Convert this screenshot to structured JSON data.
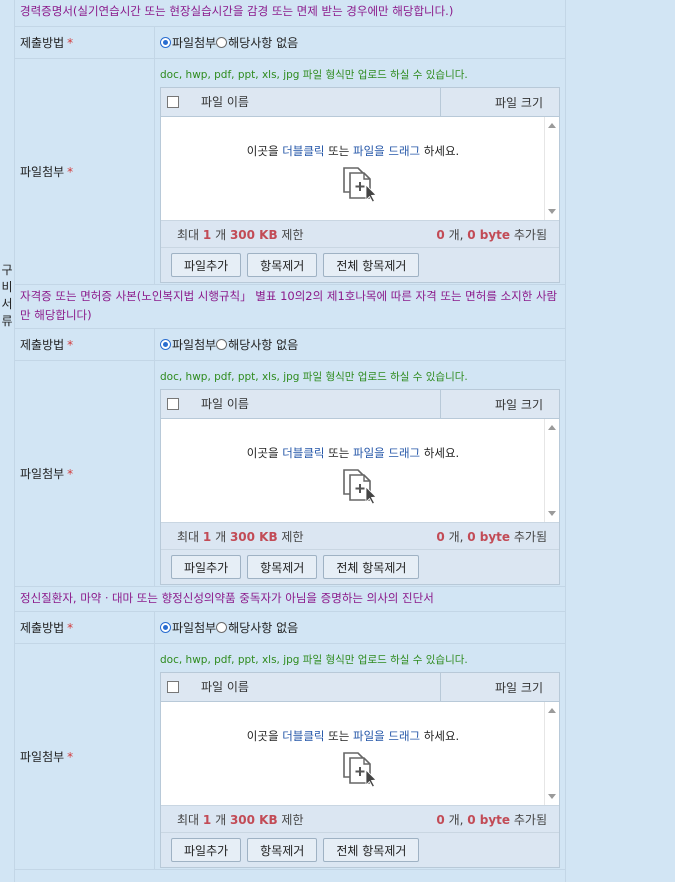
{
  "side_label": [
    "구",
    "비",
    "서",
    "류"
  ],
  "labels": {
    "method": "제출방법",
    "required_mark": "*",
    "attach": "파일첨부"
  },
  "radio": {
    "attach": "파일첨부",
    "none": "해당사항 없음"
  },
  "uploader": {
    "hint": "doc, hwp, pdf, ppt, xls, jpg 파일 형식만 업로드 하실 수 있습니다.",
    "col_name": "파일 이름",
    "col_size": "파일 크기",
    "drop_prefix": "이곳을 ",
    "drop_dbl": "더블클릭",
    "drop_mid": " 또는 ",
    "drop_drag": "파일을 드래그",
    "drop_suffix": " 하세요.",
    "limit_prefix": "최대 ",
    "limit_count": "1",
    "limit_mid": " 개 ",
    "limit_size": "300 KB",
    "limit_suffix": " 제한",
    "added_count": "0",
    "added_mid": " 개, ",
    "added_bytes": "0 byte",
    "added_suffix": " 추가됨",
    "btn_add": "파일추가",
    "btn_remove": "항목제거",
    "btn_remove_all": "전체 항목제거"
  },
  "sections": [
    {
      "title": "경력증명서(실기연습시간 또는 현장실습시간을 감경 또는 면제 받는 경우에만 해당합니다.)"
    },
    {
      "title": "자격증 또는 면허증 사본(노인복지법 시행규칙」 별표 10의2의 제1호나목에 따른 자격 또는 면허를 소지한 사람만 해당합니다)"
    },
    {
      "title": "정신질환자, 마약ㆍ대마 또는 향정신성의약품 중독자가 아님을 증명하는 의사의 진단서"
    }
  ]
}
